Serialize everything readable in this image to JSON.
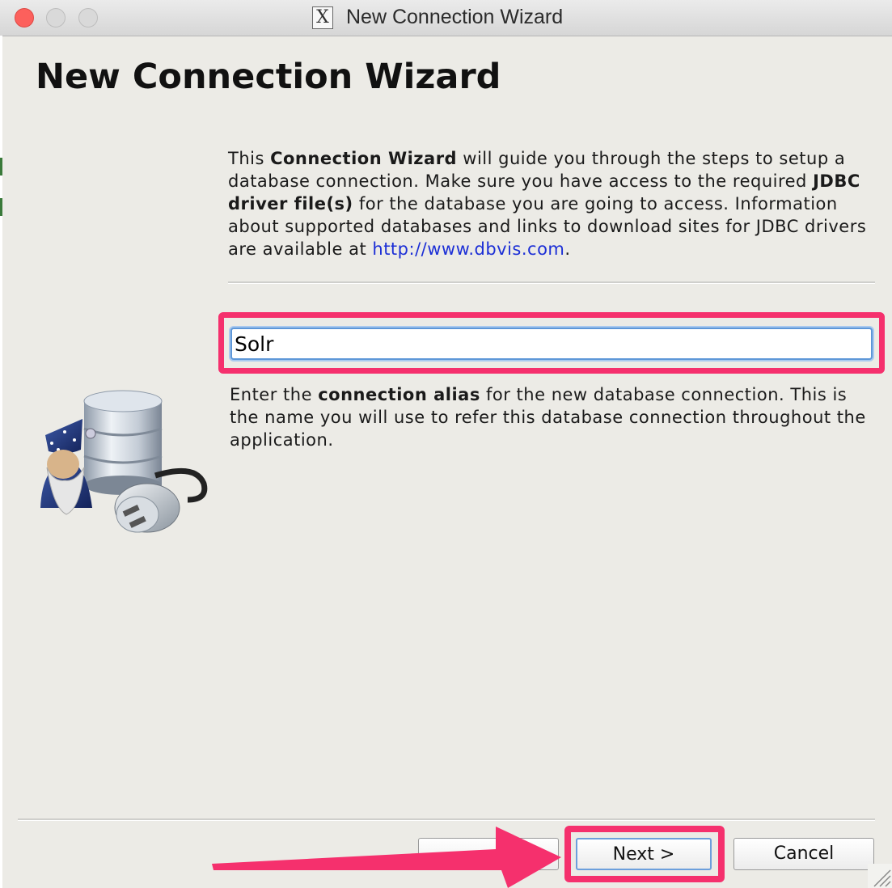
{
  "window": {
    "title": "New Connection Wizard",
    "app_icon_glyph": "X"
  },
  "page": {
    "title": "New Connection Wizard"
  },
  "intro": {
    "p1": "This ",
    "b1": "Connection Wizard",
    "p2": " will guide you through the steps to setup a database connection. Make sure you have access to the required ",
    "b2": "JDBC driver file(s)",
    "p3": " for the database you are going to access. Information about supported databases and links to download sites for JDBC drivers are available at ",
    "link": "http://www.dbvis.com",
    "p4": "."
  },
  "alias_field": {
    "value": "Solr"
  },
  "help": {
    "p1": "Enter the ",
    "b1": "connection alias",
    "p2": " for the new database connection. This is the name you will use to refer this database connection throughout the application."
  },
  "buttons": {
    "back": "",
    "next": "Next >",
    "cancel": "Cancel"
  },
  "colors": {
    "highlight": "#f5306d",
    "link": "#1c2fd6",
    "focus": "#5e97d8",
    "background": "#ecebe6"
  },
  "icons": [
    "wizard-database-icon",
    "resize-grip-icon",
    "app-x11-icon"
  ]
}
